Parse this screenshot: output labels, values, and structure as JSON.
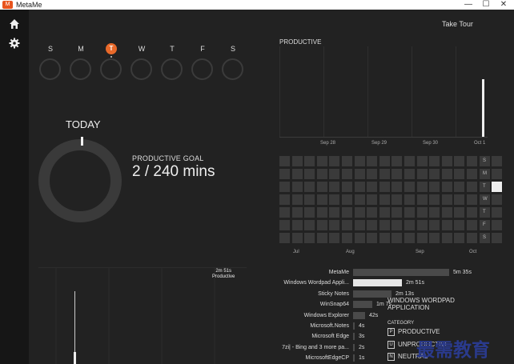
{
  "window": {
    "title": "MetaMe",
    "logo": "M",
    "controls": [
      "—",
      "☐",
      "✕"
    ]
  },
  "sidebar": {
    "icons": [
      "home-icon",
      "gear-icon"
    ]
  },
  "week": {
    "days": [
      "S",
      "M",
      "T",
      "W",
      "T",
      "F",
      "S"
    ],
    "today_index": 2
  },
  "today": {
    "label": "TODAY",
    "goal_label": "PRODUCTIVE GOAL",
    "goal_value": "2 / 240 mins",
    "progress_fraction": 0.008
  },
  "header": {
    "take_tour": "Take Tour"
  },
  "productive": {
    "title": "PRODUCTIVE",
    "dates": [
      "Sep 28",
      "Sep 29",
      "Sep 30",
      "Oct 1"
    ]
  },
  "heatmap": {
    "weekdays": [
      "S",
      "M",
      "T",
      "W",
      "T",
      "F",
      "S"
    ],
    "months": [
      "Jul",
      "Aug",
      "Sep",
      "Oct"
    ],
    "highlight": {
      "row": 2,
      "col": 17
    }
  },
  "bottom_chart": {
    "label_time": "2m 51s",
    "label_cat": "Productive"
  },
  "apps": [
    {
      "name": "MetaMe",
      "time": "5m 35s",
      "fraction": 1.0,
      "selected": false
    },
    {
      "name": "Windows Wordpad Appli...",
      "time": "2m 51s",
      "fraction": 0.51,
      "selected": true
    },
    {
      "name": "Sticky Notes",
      "time": "2m 13s",
      "fraction": 0.4,
      "selected": false
    },
    {
      "name": "WinSnap64",
      "time": "1m 7s",
      "fraction": 0.2,
      "selected": false
    },
    {
      "name": "Windows Explorer",
      "time": "42s",
      "fraction": 0.125,
      "selected": false
    },
    {
      "name": "Microsoft.Notes",
      "time": "4s",
      "fraction": 0.01,
      "selected": false
    },
    {
      "name": "Microsoft Edge",
      "time": "3s",
      "fraction": 0.008,
      "selected": false
    },
    {
      "name": "7zi| - Bing and 3 more pa...",
      "time": "2s",
      "fraction": 0.006,
      "selected": false
    },
    {
      "name": "MicrosoftEdgeCP",
      "time": "1s",
      "fraction": 0.003,
      "selected": false
    }
  ],
  "detail": {
    "title": "WINDOWS WORDPAD APPLICATION",
    "category_label": "CATEGORY",
    "categories": [
      {
        "key": "P",
        "label": "PRODUCTIVE"
      },
      {
        "key": "U",
        "label": "UNPRODUCTIVE"
      },
      {
        "key": "N",
        "label": "NEUTRAL"
      }
    ]
  },
  "watermark": "最需教育"
}
